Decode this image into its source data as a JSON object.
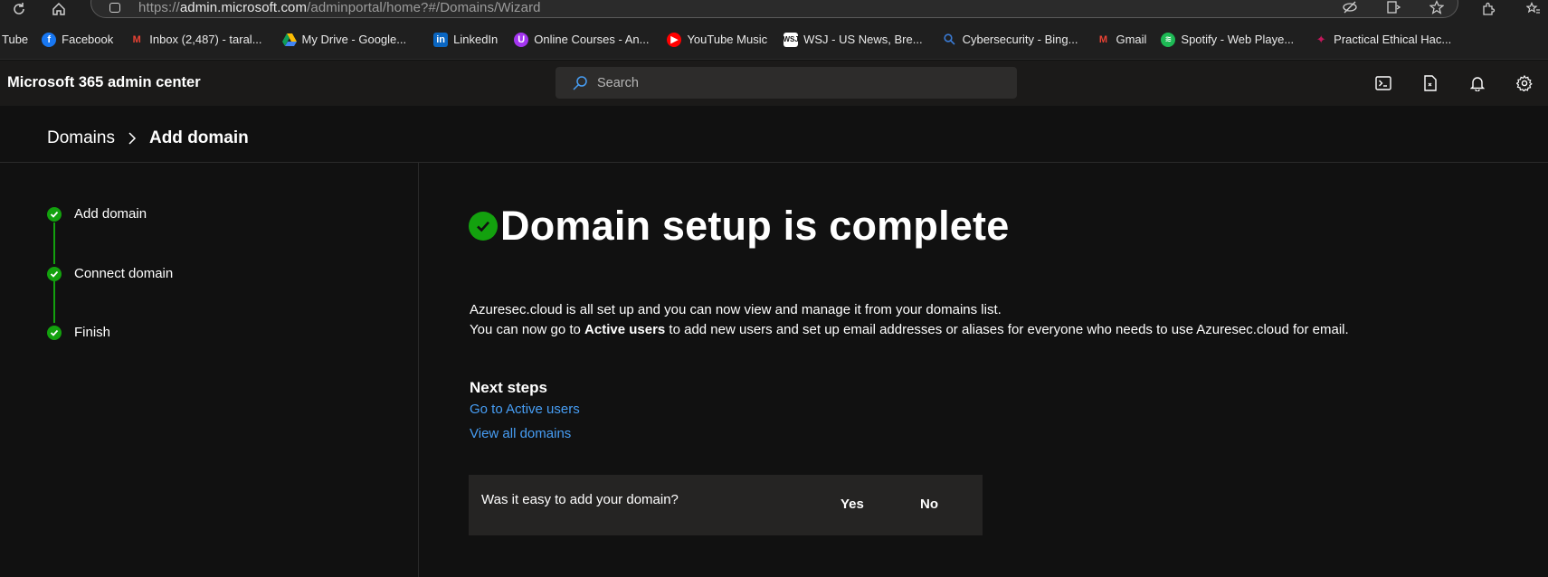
{
  "browser": {
    "url_prefix": "https://",
    "url_host": "admin.microsoft.com",
    "url_path": "/adminportal/home?#/Domains/Wizard"
  },
  "bookmarks": [
    {
      "label": "Tube",
      "icon": "youtube-icon"
    },
    {
      "label": "Facebook",
      "icon": "facebook-icon",
      "color": "#1877f2"
    },
    {
      "label": "Inbox (2,487) - taral...",
      "icon": "gmail-icon",
      "color": "#ea4335"
    },
    {
      "label": "My Drive - Google...",
      "icon": "google-drive-icon",
      "color": "#fbbc04"
    },
    {
      "label": "LinkedIn",
      "icon": "linkedin-icon",
      "color": "#0a66c2"
    },
    {
      "label": "Online Courses - An...",
      "icon": "udemy-icon",
      "color": "#a435f0"
    },
    {
      "label": "YouTube Music",
      "icon": "youtube-music-icon",
      "color": "#ff0000"
    },
    {
      "label": "WSJ - US News, Bre...",
      "icon": "wsj-icon",
      "color": "#ffffff"
    },
    {
      "label": "Cybersecurity - Bing...",
      "icon": "bing-search-icon",
      "color": "#3a7bd5"
    },
    {
      "label": "Gmail",
      "icon": "gmail-icon",
      "color": "#ea4335"
    },
    {
      "label": "Spotify - Web Playe...",
      "icon": "spotify-icon",
      "color": "#1db954"
    },
    {
      "label": "Practical Ethical Hac...",
      "icon": "tcm-icon",
      "color": "#c2185b"
    }
  ],
  "header": {
    "title": "Microsoft 365 admin center",
    "search_placeholder": "Search"
  },
  "breadcrumb": {
    "parent": "Domains",
    "current": "Add domain"
  },
  "steps": [
    {
      "label": "Add domain"
    },
    {
      "label": "Connect domain"
    },
    {
      "label": "Finish"
    }
  ],
  "main": {
    "heading": "Domain setup is complete",
    "line1": "Azuresec.cloud is all set up and you can now view and manage it from your domains list.",
    "line2_pre": "You can now go to ",
    "line2_bold": "Active users",
    "line2_post": " to add new users and set up email addresses or aliases for everyone who needs to use Azuresec.cloud for email.",
    "next_steps_heading": "Next steps",
    "link_active_users": "Go to Active users",
    "link_all_domains": "View all domains"
  },
  "feedback": {
    "question": "Was it easy to add your domain?",
    "yes": "Yes",
    "no": "No"
  },
  "colors": {
    "accent_green": "#13a10e",
    "link_blue": "#479ef5"
  }
}
